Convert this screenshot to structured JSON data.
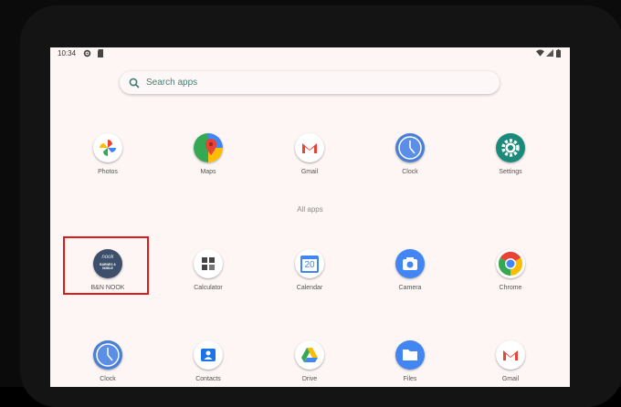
{
  "status_bar": {
    "time": "10:34"
  },
  "search": {
    "placeholder": "Search apps"
  },
  "favorites": [
    {
      "label": "Photos"
    },
    {
      "label": "Maps"
    },
    {
      "label": "Gmail"
    },
    {
      "label": "Clock"
    },
    {
      "label": "Settings"
    }
  ],
  "section": {
    "all_apps_label": "All apps"
  },
  "all_apps_row1": [
    {
      "label": "B&N NOOK",
      "icon_text": "nook",
      "icon_text2": "BARNES & NOBLE"
    },
    {
      "label": "Calculator"
    },
    {
      "label": "Calendar",
      "icon_text": "20"
    },
    {
      "label": "Camera"
    },
    {
      "label": "Chrome"
    }
  ],
  "all_apps_row2": [
    {
      "label": "Clock"
    },
    {
      "label": "Contacts"
    },
    {
      "label": "Drive"
    },
    {
      "label": "Files"
    },
    {
      "label": "Gmail"
    }
  ],
  "colors": {
    "screen_bg": "#fdf6f5",
    "highlight": "#e01919",
    "search_accent": "#4a7c7a"
  }
}
